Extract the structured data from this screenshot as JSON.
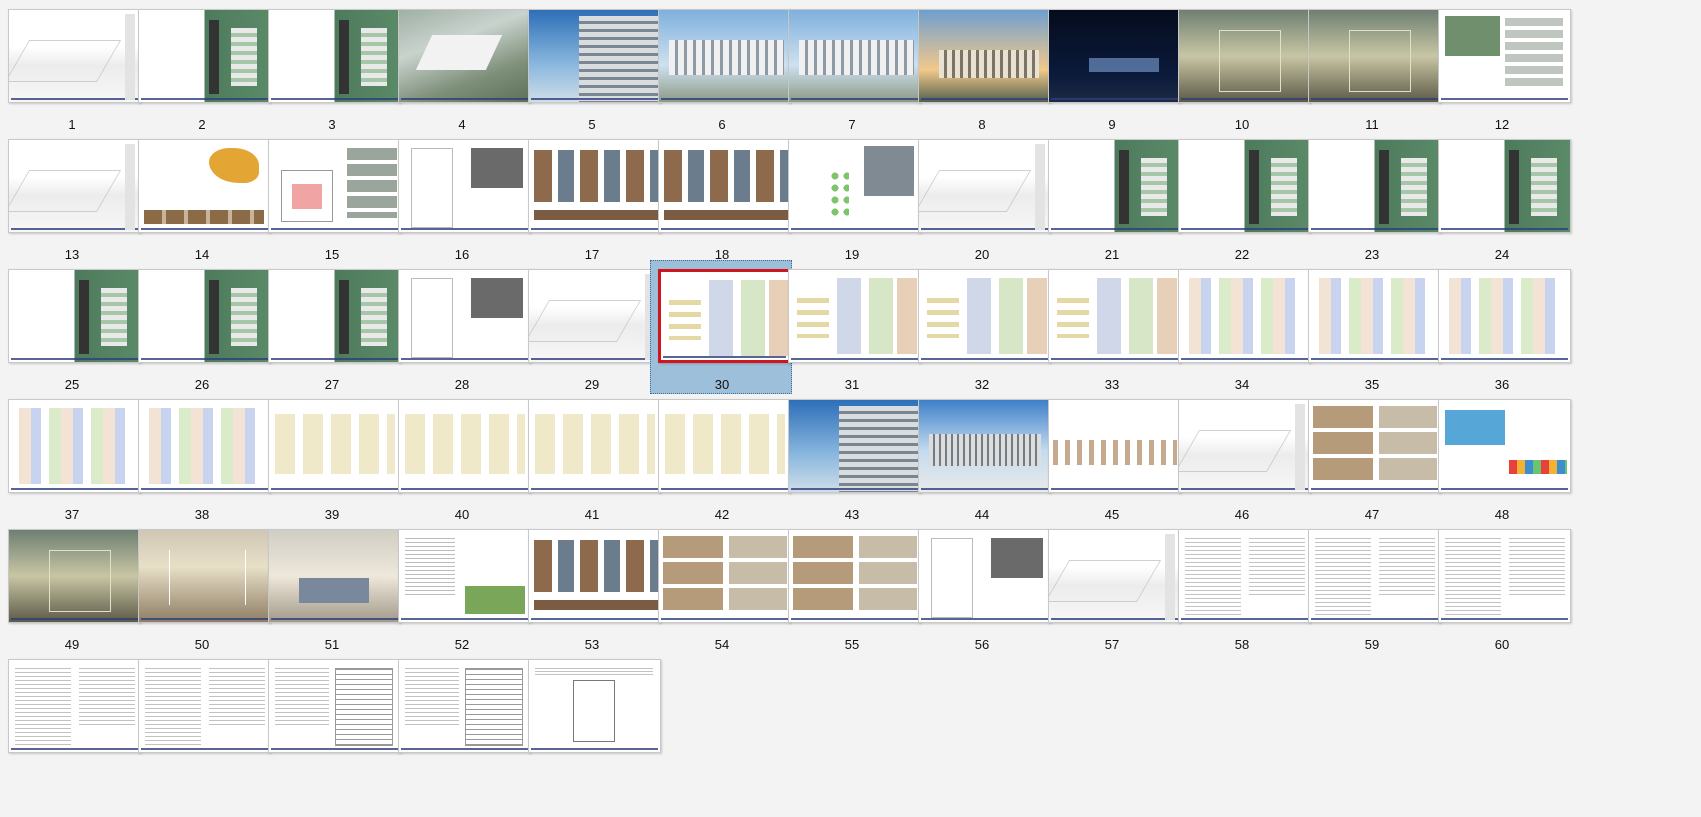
{
  "selected_slide": "30",
  "slides": [
    {
      "number": "1",
      "art": "sketch"
    },
    {
      "number": "2",
      "art": "site"
    },
    {
      "number": "3",
      "art": "site"
    },
    {
      "number": "4",
      "art": "aerial"
    },
    {
      "number": "5",
      "art": "tower"
    },
    {
      "number": "6",
      "art": "sky"
    },
    {
      "number": "7",
      "art": "sky"
    },
    {
      "number": "8",
      "art": "dusk"
    },
    {
      "number": "9",
      "art": "night"
    },
    {
      "number": "10",
      "art": "interior"
    },
    {
      "number": "11",
      "art": "interior"
    },
    {
      "number": "12",
      "art": "board"
    },
    {
      "number": "13",
      "art": "sketch"
    },
    {
      "number": "14",
      "art": "map"
    },
    {
      "number": "15",
      "art": "plan"
    },
    {
      "number": "16",
      "art": "diagram"
    },
    {
      "number": "17",
      "art": "collage"
    },
    {
      "number": "18",
      "art": "collage"
    },
    {
      "number": "19",
      "art": "green"
    },
    {
      "number": "20",
      "art": "sketch"
    },
    {
      "number": "21",
      "art": "site"
    },
    {
      "number": "22",
      "art": "site"
    },
    {
      "number": "23",
      "art": "site"
    },
    {
      "number": "24",
      "art": "site"
    },
    {
      "number": "25",
      "art": "site"
    },
    {
      "number": "26",
      "art": "site"
    },
    {
      "number": "27",
      "art": "site"
    },
    {
      "number": "28",
      "art": "diagram"
    },
    {
      "number": "29",
      "art": "sketch"
    },
    {
      "number": "30",
      "art": "floor"
    },
    {
      "number": "31",
      "art": "floor"
    },
    {
      "number": "32",
      "art": "floor"
    },
    {
      "number": "33",
      "art": "floor"
    },
    {
      "number": "34",
      "art": "floor2"
    },
    {
      "number": "35",
      "art": "floor2"
    },
    {
      "number": "36",
      "art": "floor2"
    },
    {
      "number": "37",
      "art": "floor2"
    },
    {
      "number": "38",
      "art": "floor2"
    },
    {
      "number": "39",
      "art": "elev"
    },
    {
      "number": "40",
      "art": "elev"
    },
    {
      "number": "41",
      "art": "elev"
    },
    {
      "number": "42",
      "art": "elev"
    },
    {
      "number": "43",
      "art": "tower"
    },
    {
      "number": "44",
      "art": "facade"
    },
    {
      "number": "45",
      "art": "section"
    },
    {
      "number": "46",
      "art": "sketch"
    },
    {
      "number": "47",
      "art": "photos"
    },
    {
      "number": "48",
      "art": "swatch"
    },
    {
      "number": "49",
      "art": "interior"
    },
    {
      "number": "50",
      "art": "corridor"
    },
    {
      "number": "51",
      "art": "room"
    },
    {
      "number": "52",
      "art": "textimg"
    },
    {
      "number": "53",
      "art": "collage"
    },
    {
      "number": "54",
      "art": "photos"
    },
    {
      "number": "55",
      "art": "photos"
    },
    {
      "number": "56",
      "art": "diagram"
    },
    {
      "number": "57",
      "art": "sketch"
    },
    {
      "number": "58",
      "art": "textonly"
    },
    {
      "number": "59",
      "art": "textonly"
    },
    {
      "number": "60",
      "art": "textonly"
    },
    {
      "number": "",
      "art": "textonly"
    },
    {
      "number": "",
      "art": "textonly"
    },
    {
      "number": "",
      "art": "table"
    },
    {
      "number": "",
      "art": "table"
    },
    {
      "number": "",
      "art": "chart"
    }
  ]
}
